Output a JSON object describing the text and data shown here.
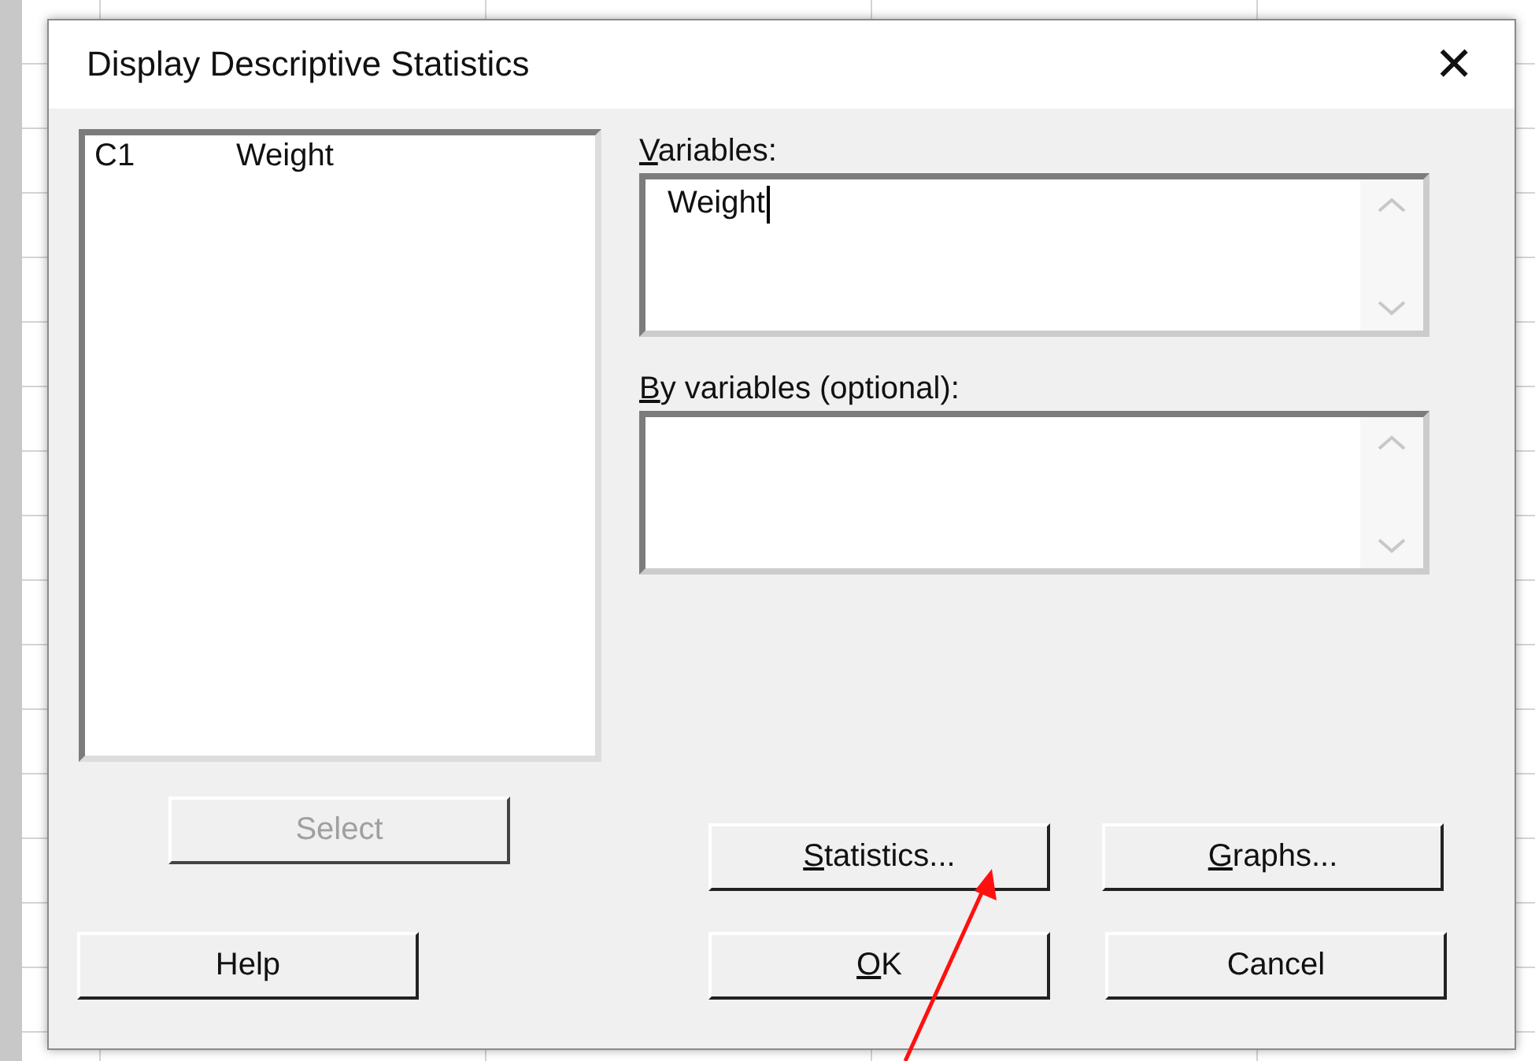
{
  "window": {
    "title": "Display Descriptive Statistics",
    "close": "✕"
  },
  "columns_list": [
    {
      "column": "C1",
      "name": "Weight"
    }
  ],
  "variables": {
    "label": {
      "key": "V",
      "rest": "ariables:"
    },
    "value": "Weight"
  },
  "by_variables": {
    "label": {
      "key": "B",
      "rest": "y variables (optional):"
    }
  },
  "buttons": [
    {
      "kind": "select",
      "label": {
        "rest": "Select"
      },
      "disabled": true
    },
    {
      "kind": "statistics",
      "label": {
        "key": "S",
        "rest": "tatistics..."
      },
      "disabled": false
    },
    {
      "kind": "graphs",
      "label": {
        "key": "G",
        "rest": "raphs..."
      },
      "disabled": false
    },
    {
      "kind": "help",
      "label": {
        "rest": "Help"
      },
      "disabled": false
    },
    {
      "kind": "ok",
      "label": {
        "key": "O",
        "rest": "K"
      },
      "disabled": false
    },
    {
      "kind": "cancel",
      "label": {
        "rest": "Cancel"
      },
      "disabled": false
    }
  ]
}
